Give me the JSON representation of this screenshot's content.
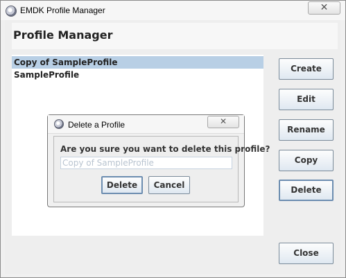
{
  "window": {
    "title": "EMDK Profile Manager",
    "close_glyph": "✕"
  },
  "header": {
    "title": "Profile Manager"
  },
  "profiles": [
    {
      "label": "Copy of SampleProfile",
      "selected": true
    },
    {
      "label": "SampleProfile",
      "selected": false
    }
  ],
  "buttons": {
    "create": "Create",
    "edit": "Edit",
    "rename": "Rename",
    "copy": "Copy",
    "delete": "Delete",
    "close": "Close"
  },
  "dialog": {
    "title": "Delete a Profile",
    "close_glyph": "✕",
    "question": "Are you sure you want to delete this profile?",
    "profile_name": "Copy of SampleProfile",
    "delete_label": "Delete",
    "cancel_label": "Cancel"
  },
  "colors": {
    "selection": "#b8cfe5",
    "button_border": "#7a8a99",
    "window_bg": "#f0f0f0"
  }
}
